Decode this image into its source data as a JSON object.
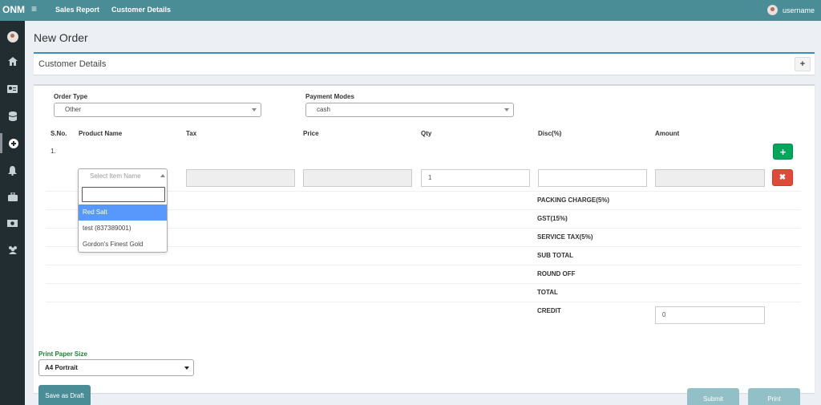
{
  "app": {
    "logo": "ONM",
    "nav": [
      "Sales Report",
      "Customer Details"
    ],
    "username": "username"
  },
  "sidebar": {
    "icons": [
      "avatar-icon",
      "home-icon",
      "id-card-icon",
      "database-icon",
      "plus-circle-icon",
      "bell-icon",
      "briefcase-icon",
      "money-icon",
      "users-icon"
    ],
    "active_index": 4
  },
  "page": {
    "title": "New Order"
  },
  "customer_box": {
    "title": "Customer Details",
    "expand_label": "+"
  },
  "order": {
    "order_type_label": "Order Type",
    "order_type_value": "Other",
    "payment_modes_label": "Payment Modes",
    "payment_modes_value": "cash"
  },
  "table": {
    "headers": [
      "S.No.",
      "Product Name",
      "Tax",
      "Price",
      "Qty",
      "Disc(%)",
      "Amount"
    ],
    "rows": [
      {
        "sno": "1.",
        "product_placeholder": "Select Item Name",
        "tax": "",
        "price": "",
        "qty": "1",
        "disc": "",
        "amount": ""
      }
    ],
    "add_label": "+",
    "remove_label": "✖"
  },
  "product_dropdown": {
    "search_value": "",
    "options": [
      "Red Salt",
      "test (837389001)",
      "Gordon's Finest Gold"
    ],
    "highlighted_index": 0
  },
  "summary": {
    "labels": [
      "PACKING CHARGE(5%)",
      "GST(15%)",
      "SERVICE TAX(5%)",
      "SUB TOTAL",
      "ROUND OFF",
      "TOTAL",
      "CREDIT"
    ],
    "credit_value": "0"
  },
  "print": {
    "label": "Print Paper Size",
    "value": "A4 Portrait"
  },
  "actions": {
    "draft": "Save as Draft",
    "submit": "Submit",
    "print": "Print"
  },
  "colors": {
    "topbar": "#4a8d96",
    "sidebar": "#222d32",
    "success": "#00a65a",
    "danger": "#dd4b39",
    "highlight": "#5897fb",
    "disabled_button": "#92c0c6"
  }
}
